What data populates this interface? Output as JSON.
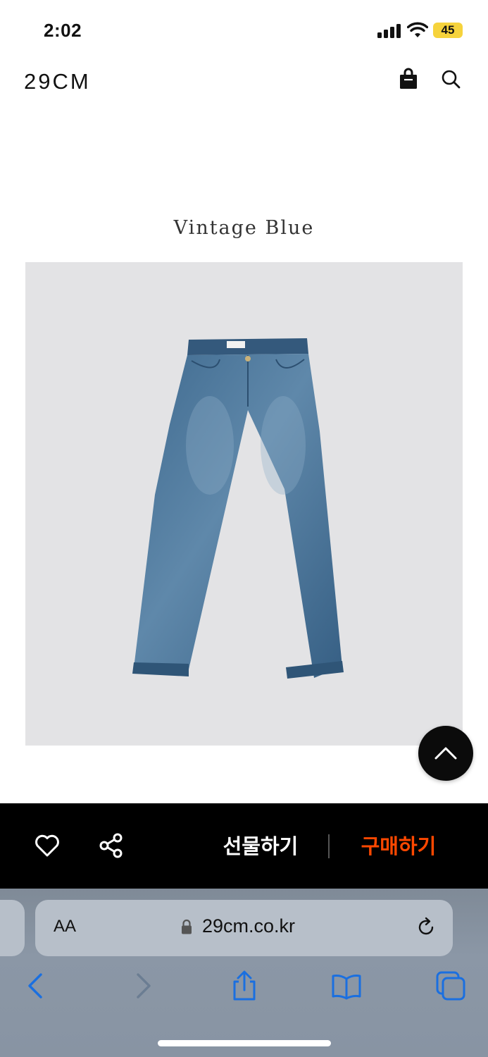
{
  "status_bar": {
    "time": "2:02",
    "battery": "45",
    "battery_color": "#f6d33c"
  },
  "header": {
    "logo": "29CM",
    "icons": [
      "shopping-bag-icon",
      "search-icon"
    ]
  },
  "product": {
    "color_title": "Vintage Blue",
    "image_background": "#e3e3e5",
    "image_subject": "jeans"
  },
  "purchase_bar": {
    "gift_label": "선물하기",
    "buy_label": "구매하기",
    "buy_color": "#ff4800",
    "icons": [
      "heart-icon",
      "share-icon"
    ]
  },
  "browser": {
    "aa_label": "AA",
    "url": "29cm.co.kr",
    "icons": [
      "lock-icon",
      "reload-icon",
      "back-icon",
      "forward-icon",
      "share-icon",
      "bookmarks-icon",
      "tabs-icon"
    ],
    "accent_color": "#1a6fe0"
  }
}
